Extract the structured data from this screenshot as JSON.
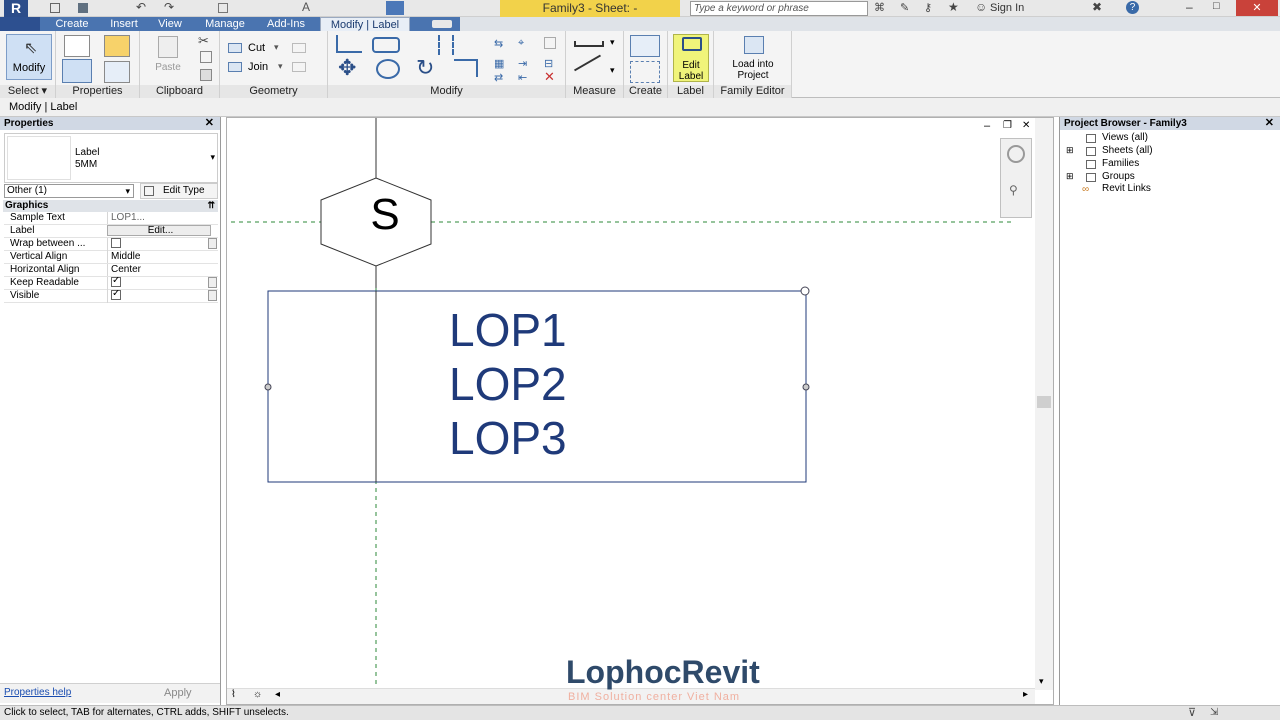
{
  "app": {
    "title": "Family3 - Sheet: -",
    "search_placeholder": "Type a keyword or phrase",
    "sign_in": "Sign In"
  },
  "tabs": [
    "Create",
    "Insert",
    "View",
    "Manage",
    "Add-Ins",
    "Modify | Label"
  ],
  "ribbon": {
    "modify": "Modify",
    "select": "Select",
    "properties": "Properties",
    "clipboard": "Clipboard",
    "paste": "Paste",
    "cut": "Cut",
    "join": "Join",
    "geometry": "Geometry",
    "modify_panel": "Modify",
    "measure": "Measure",
    "create": "Create",
    "edit_label_line1": "Edit",
    "edit_label_line2": "Label",
    "label_panel": "Label",
    "load_line1": "Load into",
    "load_line2": "Project",
    "family_editor": "Family Editor"
  },
  "context_bar": "Modify | Label",
  "properties": {
    "header": "Properties",
    "type_name": "Label",
    "type_sub": "5MM",
    "selector": "Other (1)",
    "edit_type": "Edit Type",
    "group": "Graphics",
    "rows": [
      {
        "key": "Sample Text",
        "value": "LOP1..."
      },
      {
        "key": "Label",
        "value": "Edit..."
      },
      {
        "key": "Wrap between ...",
        "value": ""
      },
      {
        "key": "Vertical Align",
        "value": "Middle"
      },
      {
        "key": "Horizontal Align",
        "value": "Center"
      },
      {
        "key": "Keep Readable",
        "value": ""
      },
      {
        "key": "Visible",
        "value": ""
      }
    ],
    "checks": {
      "wrap": false,
      "keep_readable": true,
      "visible": true
    },
    "help": "Properties help",
    "apply": "Apply"
  },
  "canvas": {
    "tag_letter": "S",
    "label_lines": [
      "LOP1",
      "LOP2",
      "LOP3"
    ],
    "watermark_brand": "LophocRevit",
    "watermark_sub": "BIM Solution center Viet Nam"
  },
  "browser": {
    "header": "Project Browser - Family3",
    "items": [
      "Views (all)",
      "Sheets (all)",
      "Families",
      "Groups",
      "Revit Links"
    ]
  },
  "status": "Click to select, TAB for alternates, CTRL adds, SHIFT unselects.",
  "colors": {
    "label_blue": "#1f3a7a",
    "tab_active": "#e8eef6",
    "highlight": "#f0f47a"
  }
}
